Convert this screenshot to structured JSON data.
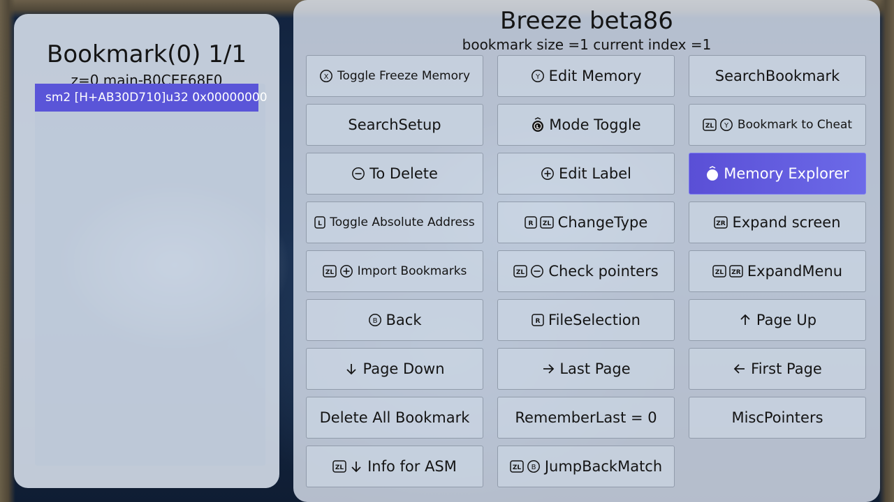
{
  "left": {
    "title": "Bookmark(0) 1/1",
    "subtitle": "z=0 main-B0CEF68F0",
    "items": [
      "sm2 [H+AB30D710]u32 0x00000000"
    ]
  },
  "header": {
    "title": "Breeze beta86",
    "subtitle": "bookmark size =1 current index =1"
  },
  "buttons": [
    {
      "label": "Toggle Freeze Memory",
      "icons": [
        "x-button-icon"
      ],
      "small": true
    },
    {
      "label": "Edit Memory",
      "icons": [
        "y-button-icon"
      ]
    },
    {
      "label": "SearchBookmark",
      "icons": []
    },
    {
      "label": "SearchSetup",
      "icons": []
    },
    {
      "label": "Mode Toggle",
      "icons": [
        "left-stick-icon"
      ]
    },
    {
      "label": "Bookmark to Cheat",
      "icons": [
        "zl-button-icon",
        "y-button-icon"
      ],
      "small": true
    },
    {
      "label": "To Delete",
      "icons": [
        "minus-button-icon"
      ]
    },
    {
      "label": "Edit Label",
      "icons": [
        "plus-button-icon"
      ]
    },
    {
      "label": "Memory Explorer",
      "icons": [
        "right-stick-icon"
      ],
      "active": true
    },
    {
      "label": "Toggle Absolute Address",
      "icons": [
        "l-button-icon"
      ],
      "small": true
    },
    {
      "label": "ChangeType",
      "icons": [
        "r-button-icon",
        "zl-button-icon"
      ]
    },
    {
      "label": "Expand screen",
      "icons": [
        "zr-button-icon"
      ]
    },
    {
      "label": "Import Bookmarks",
      "icons": [
        "zl-button-icon",
        "plus-button-icon"
      ],
      "small": true
    },
    {
      "label": "Check pointers",
      "icons": [
        "zl-button-icon",
        "minus-button-icon"
      ]
    },
    {
      "label": "ExpandMenu",
      "icons": [
        "zl-button-icon",
        "zr-button-icon"
      ]
    },
    {
      "label": "Back",
      "icons": [
        "b-button-icon"
      ]
    },
    {
      "label": "FileSelection",
      "icons": [
        "r-button-icon"
      ]
    },
    {
      "label": "Page Up",
      "icons": [
        "arrow-up-icon"
      ]
    },
    {
      "label": "Page Down",
      "icons": [
        "arrow-down-icon"
      ]
    },
    {
      "label": "Last Page",
      "icons": [
        "arrow-right-icon"
      ]
    },
    {
      "label": "First Page",
      "icons": [
        "arrow-left-icon"
      ]
    },
    {
      "label": "Delete All Bookmark",
      "icons": []
    },
    {
      "label": "RememberLast = 0",
      "icons": []
    },
    {
      "label": "MiscPointers",
      "icons": []
    },
    {
      "label": "Info for ASM",
      "icons": [
        "zl-button-icon",
        "arrow-down-icon"
      ]
    },
    {
      "label": "JumpBackMatch",
      "icons": [
        "zl-button-icon",
        "b-button-icon"
      ]
    }
  ],
  "colors": {
    "accent": "#5a55d8",
    "panel": "#dee6f2",
    "text": "#141414"
  }
}
